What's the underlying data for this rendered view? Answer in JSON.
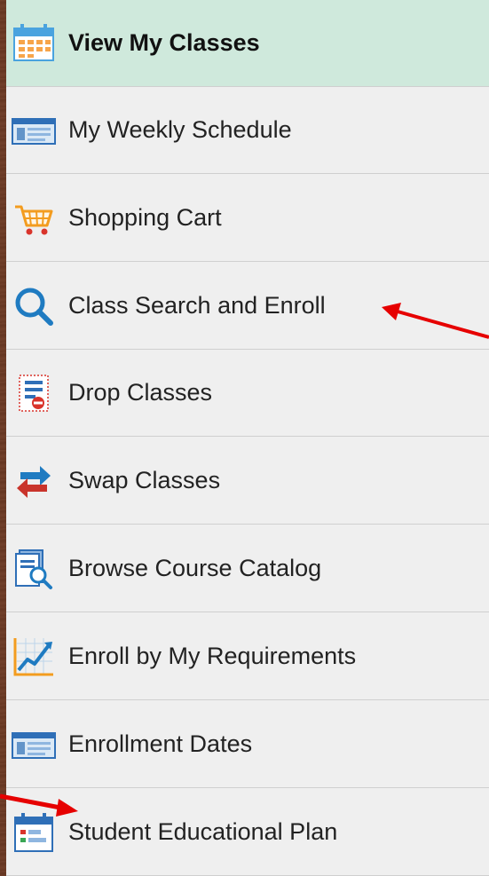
{
  "menu": {
    "items": [
      {
        "label": "View My Classes",
        "icon": "calendar-icon",
        "active": true
      },
      {
        "label": "My Weekly Schedule",
        "icon": "schedule-icon",
        "active": false
      },
      {
        "label": "Shopping Cart",
        "icon": "shopping-cart-icon",
        "active": false
      },
      {
        "label": "Class Search and Enroll",
        "icon": "search-icon",
        "active": false
      },
      {
        "label": "Drop Classes",
        "icon": "drop-classes-icon",
        "active": false
      },
      {
        "label": "Swap Classes",
        "icon": "swap-arrows-icon",
        "active": false
      },
      {
        "label": "Browse Course Catalog",
        "icon": "catalog-search-icon",
        "active": false
      },
      {
        "label": "Enroll by My Requirements",
        "icon": "line-chart-icon",
        "active": false
      },
      {
        "label": "Enrollment Dates",
        "icon": "schedule-icon",
        "active": false
      },
      {
        "label": "Student Educational Plan",
        "icon": "calendar-plan-icon",
        "active": false
      }
    ]
  },
  "colors": {
    "active_bg": "#cfe9dc",
    "menu_bg": "#efefef",
    "annotation_arrow": "#e60000"
  }
}
